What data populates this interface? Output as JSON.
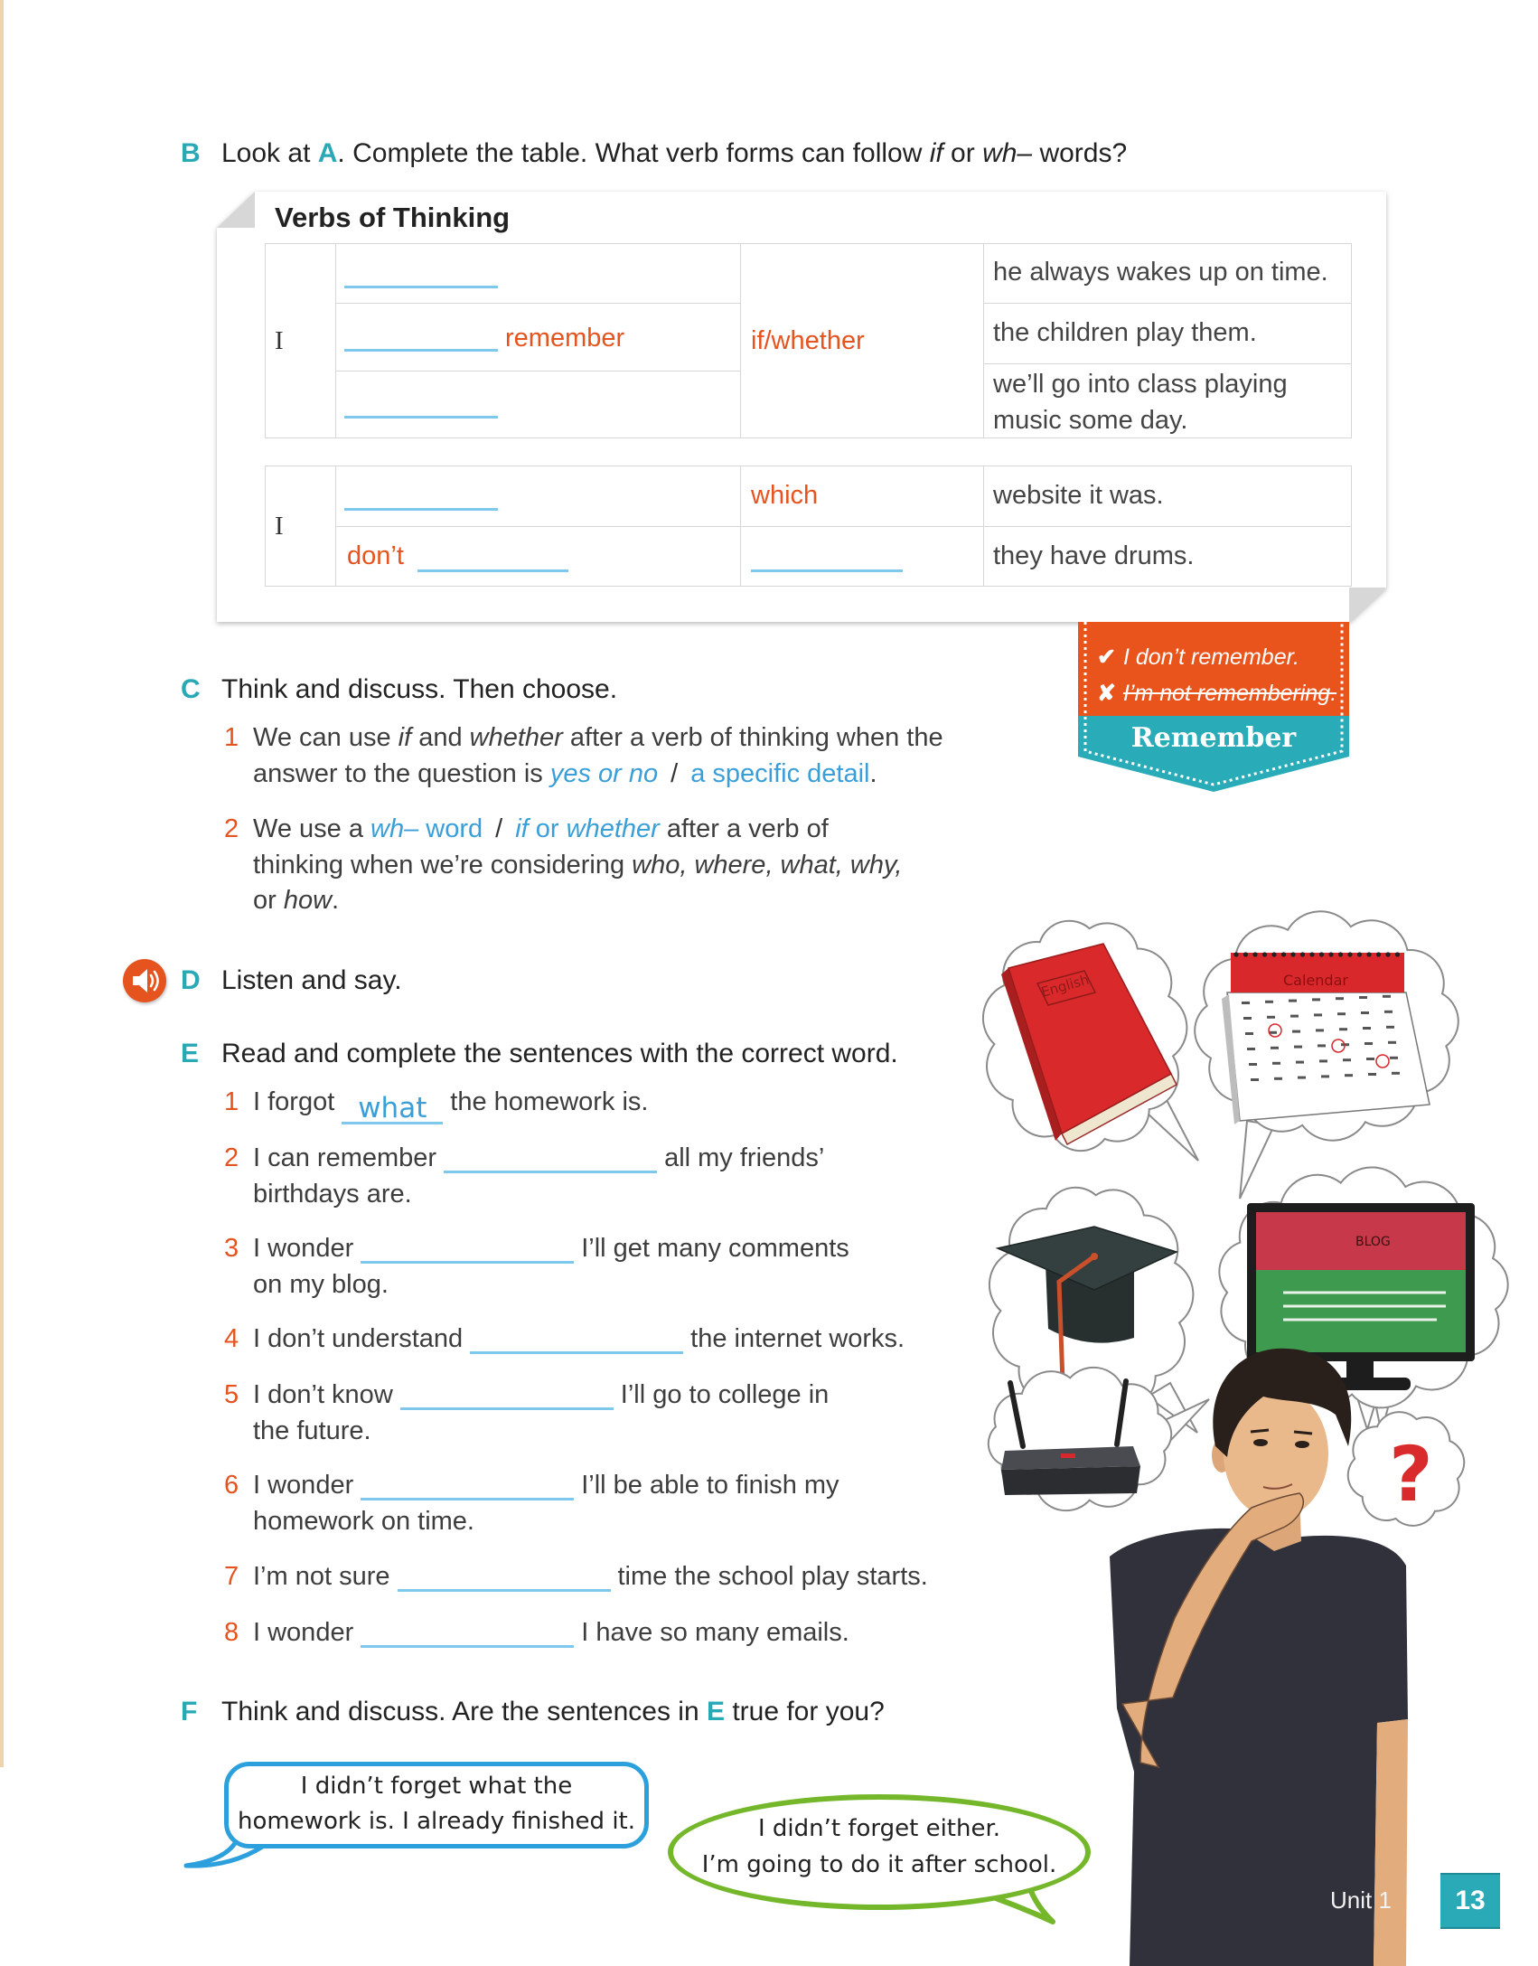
{
  "colors": {
    "teal": "#28a9b5",
    "orange": "#e5531f",
    "answer_blue": "#3a9fd8",
    "blank_line": "#7ec8ee",
    "bubble_blue": "#2ba0dc",
    "bubble_green": "#74b72b"
  },
  "sectionB": {
    "letter": "B",
    "t1": "Look at ",
    "ref": "A",
    "t2": ". Complete the table. What verb forms can follow ",
    "if": "if",
    "t3": " or ",
    "wh": "wh–",
    "t4": " words?"
  },
  "table": {
    "title": "Verbs of Thinking",
    "group1": {
      "subject": "I",
      "verb_row2": "remember",
      "connector": "if/whether",
      "clauses": [
        "he always wakes up on time.",
        "the children play them."
      ],
      "clause3_lines": [
        "we’ll go into class playing",
        "music some day."
      ]
    },
    "group2": {
      "subject": "I",
      "connector_row1": "which",
      "verb_row2_prefix": "don’t",
      "clauses": [
        "website it was.",
        "they have drums."
      ]
    }
  },
  "remember_box": {
    "correct_mark": "✔",
    "correct": "I don’t remember.",
    "incorrect_mark": "✘",
    "incorrect": "I’m not remembering.",
    "title": "Remember"
  },
  "sectionC": {
    "letter": "C",
    "instruction": "Think and discuss. Then choose.",
    "items": [
      {
        "number": "1",
        "start": "We can use ",
        "if": "if",
        "and": " and ",
        "whether": "whether",
        "end": " after a verb of thinking when the",
        "line2_start": "answer to the question is ",
        "option_a": "yes or no",
        "separator": "/",
        "option_b": "a specific detail",
        "line2_end": "."
      },
      {
        "number": "2",
        "start": "We use a ",
        "option_a_wh": "wh–",
        "option_a_word": " word",
        "separator": "/",
        "option_b_if": "if",
        "option_b_or": " or ",
        "option_b_whether": "whether",
        "end": " after a verb of",
        "line2_start": "thinking when we’re considering ",
        "line2_italic": "who, where, what, why,",
        "line3_start": "or ",
        "line3_italic": "how",
        "line3_end": "."
      }
    ]
  },
  "sectionD": {
    "letter": "D",
    "instruction": "Listen and say.",
    "audio_icon": "speaker-icon"
  },
  "sectionE": {
    "letter": "E",
    "instruction": "Read and complete the sentences with the correct word.",
    "items": [
      {
        "number": "1",
        "before": "I forgot",
        "answer": "what",
        "after": "the homework is.",
        "continuation": ""
      },
      {
        "number": "2",
        "before": "I can remember",
        "answer": "",
        "after": "all my friends’",
        "continuation": "birthdays are."
      },
      {
        "number": "3",
        "before": "I wonder",
        "answer": "",
        "after": "I’ll get many comments",
        "continuation": "on my blog."
      },
      {
        "number": "4",
        "before": "I don’t understand",
        "answer": "",
        "after": "the internet works.",
        "continuation": ""
      },
      {
        "number": "5",
        "before": "I don’t know",
        "answer": "",
        "after": "I’ll go to college in",
        "continuation": "the future."
      },
      {
        "number": "6",
        "before": "I wonder",
        "answer": "",
        "after": "I’ll be able to finish my",
        "continuation": "homework on time."
      },
      {
        "number": "7",
        "before": "I’m not sure",
        "answer": "",
        "after": "time the school play starts.",
        "continuation": ""
      },
      {
        "number": "8",
        "before": "I wonder",
        "answer": "",
        "after": "I have so many emails.",
        "continuation": ""
      }
    ]
  },
  "sectionF": {
    "letter": "F",
    "t1": "Think and discuss. Are the sentences in ",
    "ref": "E",
    "t2": " true for you?"
  },
  "speech_bubbles": [
    {
      "lines": [
        "I didn’t forget what the",
        "homework is. I already finished it."
      ]
    },
    {
      "lines": [
        "I didn’t forget either.",
        "I’m going to do it after school."
      ]
    }
  ],
  "illustration": {
    "thought_items": [
      "english-book",
      "calendar",
      "graduation-cap",
      "blog-monitor",
      "wifi-router",
      "question-mark"
    ],
    "book_label": "English",
    "calendar_label": "Calendar",
    "blog_label": "BLOG",
    "question": "?"
  },
  "footer": {
    "unit": "Unit 1",
    "page": "13"
  }
}
